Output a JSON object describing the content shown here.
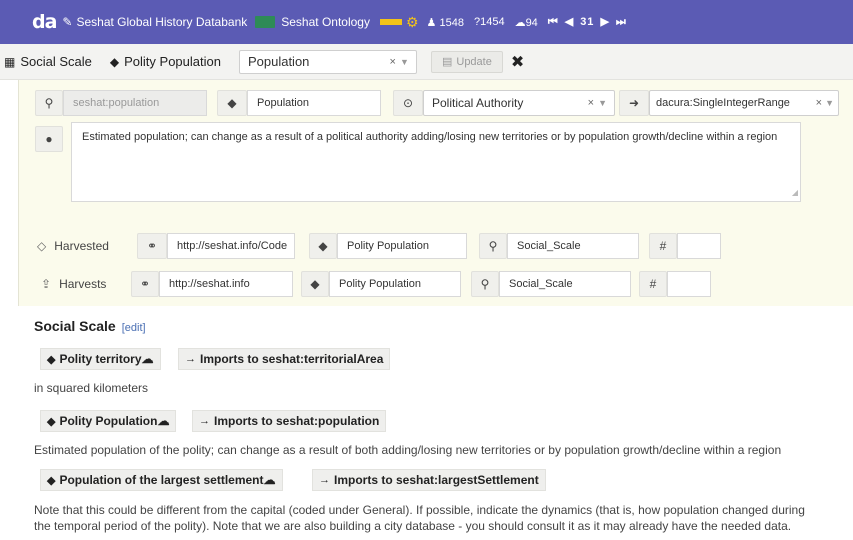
{
  "topbar": {
    "logo": "da",
    "databank": "Seshat Global History Databank",
    "ontology": "Seshat Ontology",
    "count_people": "1548",
    "count_questions": "?1454",
    "count_cloud": "94",
    "page_number": "31"
  },
  "scale_bar": {
    "scale_label": "Social Scale",
    "variable_label": "Polity Population",
    "select_value": "Population",
    "update_label": "Update"
  },
  "editor": {
    "id_value": "seshat:population",
    "label_value": "Population",
    "domain_value": "Political Authority",
    "range_value": "dacura:SingleIntegerRange",
    "comment": "Estimated population; can change as a result of a political authority adding/losing new territories or by population growth/decline within a region",
    "harvested": {
      "label": "Harvested",
      "url": "http://seshat.info/Code",
      "name": "Polity Population",
      "scale": "Social_Scale",
      "hash": "#"
    },
    "harvests": {
      "label": "Harvests",
      "url": "http://seshat.info",
      "name": "Polity Population",
      "scale": "Social_Scale",
      "hash": "#"
    }
  },
  "doc": {
    "title": "Social Scale",
    "edit": "[edit]",
    "items": [
      {
        "name": "Polity territory",
        "imports": "Imports to seshat:territorialArea",
        "note": "in squared kilometers"
      },
      {
        "name": "Polity Population",
        "imports": "Imports to seshat:population",
        "note": "Estimated population of the polity; can change as a result of both adding/losing new territories or by population growth/decline within a region"
      },
      {
        "name": "Population of the largest settlement",
        "imports": "Imports to seshat:largestSettlement",
        "note": "Note that this could be different from the capital (coded under General). If possible, indicate the dynamics (that is, how population changed during",
        "note2": "the temporal period of the polity). Note that we are also building a city database - you should consult it as it may already have the needed data."
      }
    ]
  },
  "colors": {
    "topbar": "#5b5bb4",
    "panel": "#fbfbec",
    "accent_yellow": "#f3c318",
    "flag_green": "#2e8b57"
  }
}
